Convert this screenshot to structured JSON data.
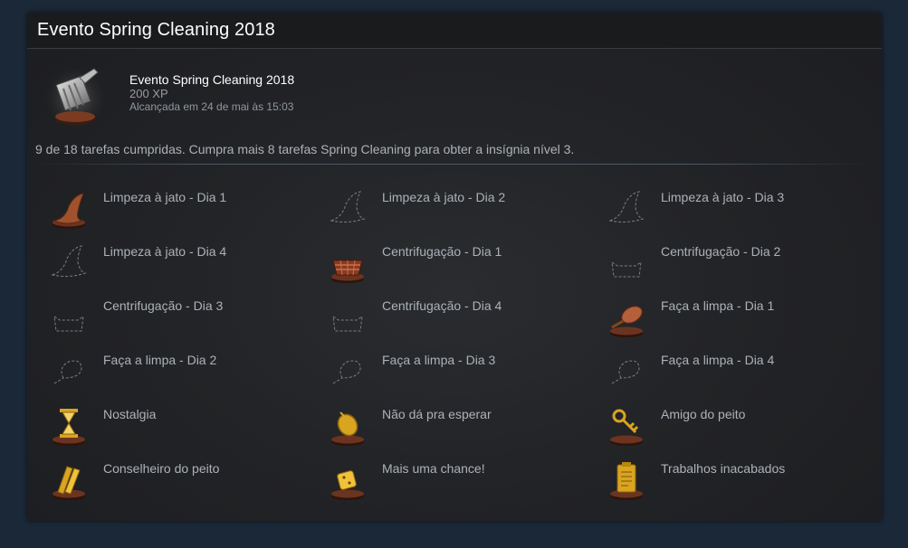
{
  "header": {
    "title": "Evento Spring Cleaning 2018"
  },
  "badge": {
    "name": "Evento Spring Cleaning 2018",
    "xp": "200 XP",
    "unlocked": "Alcançada em 24 de mai às 15:03",
    "icon": "dustpan-broom-icon"
  },
  "progress_text": "9 de 18 tarefas cumpridas. Cumpra mais 8 tarefas Spring Cleaning para obter a insígnia nível 3.",
  "tasks": [
    {
      "label": "Limpeza à jato - Dia 1",
      "icon": "hat-icon",
      "completed": true
    },
    {
      "label": "Limpeza à jato - Dia 2",
      "icon": "hat-icon",
      "completed": false
    },
    {
      "label": "Limpeza à jato - Dia 3",
      "icon": "hat-icon",
      "completed": false
    },
    {
      "label": "Limpeza à jato - Dia 4",
      "icon": "hat-icon",
      "completed": false
    },
    {
      "label": "Centrifugação - Dia 1",
      "icon": "basket-icon",
      "completed": true
    },
    {
      "label": "Centrifugação - Dia 2",
      "icon": "basket-icon",
      "completed": false
    },
    {
      "label": "Centrifugação - Dia 3",
      "icon": "basket-icon",
      "completed": false
    },
    {
      "label": "Centrifugação - Dia 4",
      "icon": "basket-icon",
      "completed": false
    },
    {
      "label": "Faça a limpa - Dia 1",
      "icon": "feather-duster-icon",
      "completed": true
    },
    {
      "label": "Faça a limpa - Dia 2",
      "icon": "feather-duster-icon",
      "completed": false
    },
    {
      "label": "Faça a limpa - Dia 3",
      "icon": "feather-duster-icon",
      "completed": false
    },
    {
      "label": "Faça a limpa - Dia 4",
      "icon": "feather-duster-icon",
      "completed": false
    },
    {
      "label": "Nostalgia",
      "icon": "hourglass-icon",
      "completed": true
    },
    {
      "label": "Não dá pra esperar",
      "icon": "pocket-watch-icon",
      "completed": true
    },
    {
      "label": "Amigo do peito",
      "icon": "key-icon",
      "completed": true
    },
    {
      "label": "Conselheiro do peito",
      "icon": "gold-bars-icon",
      "completed": true
    },
    {
      "label": "Mais uma chance!",
      "icon": "dice-icon",
      "completed": true
    },
    {
      "label": "Trabalhos inacabados",
      "icon": "clipboard-icon",
      "completed": true
    }
  ],
  "colors": {
    "background": "#1b2838",
    "panel": "#232427",
    "title_text": "#ffffff",
    "label_text": "#acb2b8",
    "pedestal": "#5a2e1c",
    "gold": "#d9a520"
  }
}
